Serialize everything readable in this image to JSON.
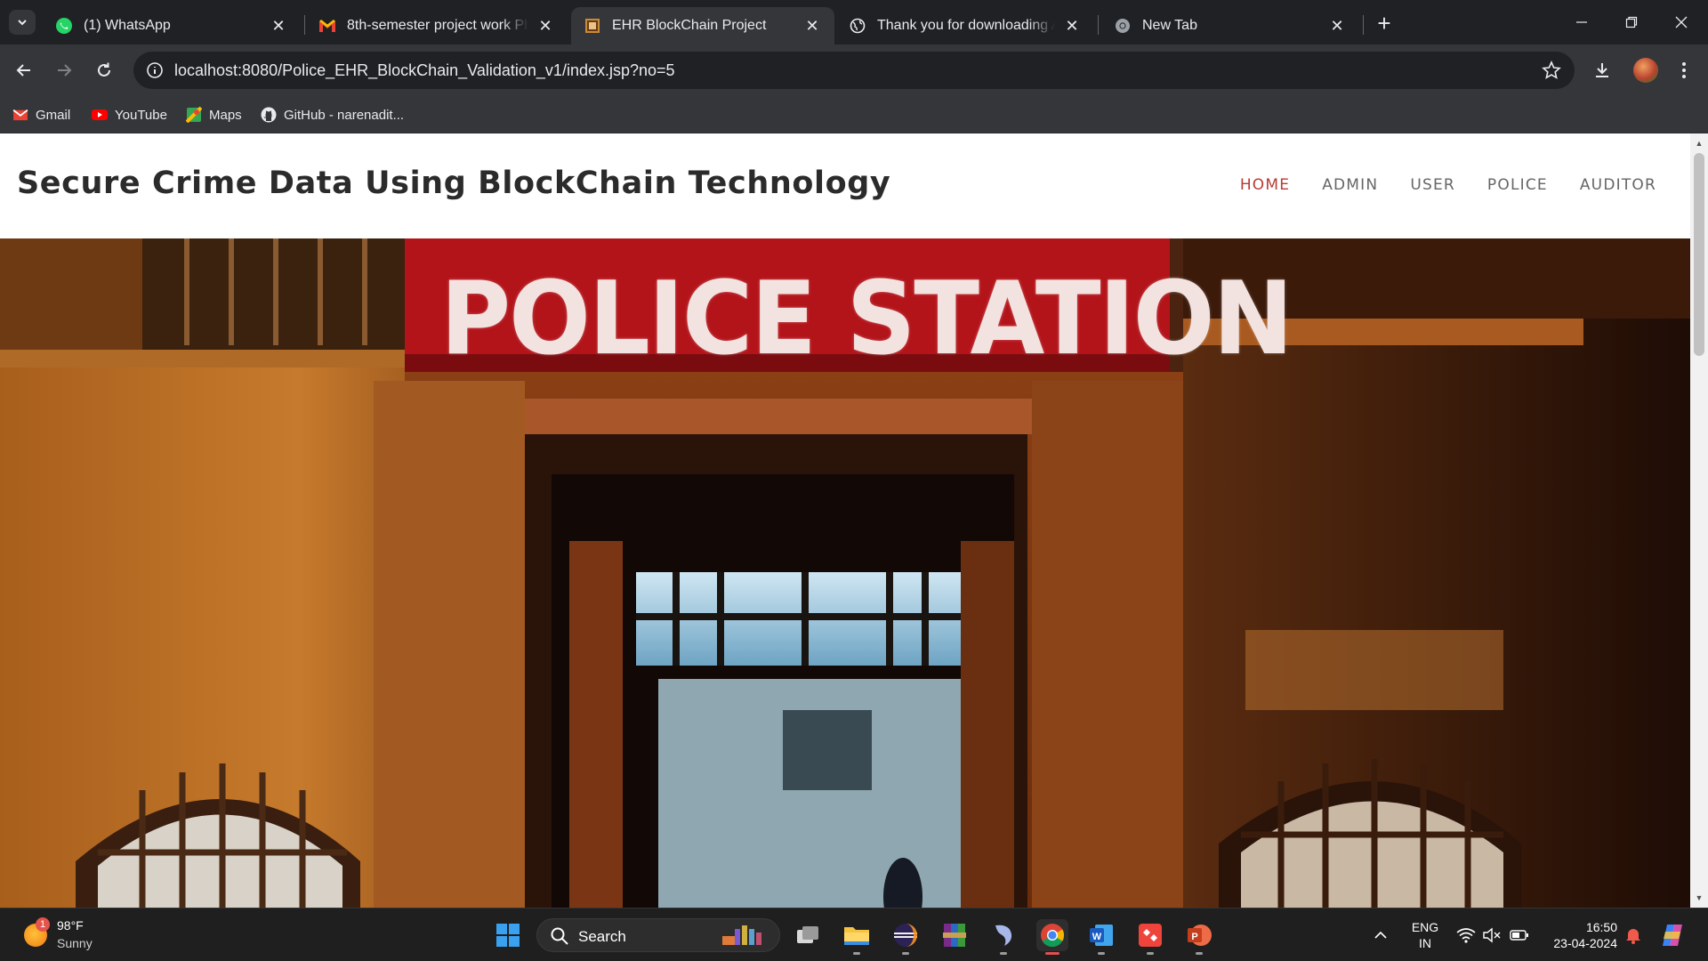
{
  "browser": {
    "tabs": [
      {
        "title": "(1) WhatsApp",
        "icon": "whatsapp-icon",
        "active": false
      },
      {
        "title": "8th-semester project work Pha",
        "icon": "gmail-icon",
        "active": false
      },
      {
        "title": "EHR BlockChain Project",
        "icon": "site-favicon-icon",
        "active": true
      },
      {
        "title": "Thank you for downloading Ar",
        "icon": "globe-icon",
        "active": false
      },
      {
        "title": "New Tab",
        "icon": "chrome-icon",
        "active": false
      }
    ],
    "new_tab_label": "+",
    "url": "localhost:8080/Police_EHR_BlockChain_Validation_v1/index.jsp?no=5",
    "bookmarks": [
      {
        "label": "Gmail",
        "icon": "gmail-icon"
      },
      {
        "label": "YouTube",
        "icon": "youtube-icon"
      },
      {
        "label": "Maps",
        "icon": "maps-icon"
      },
      {
        "label": "GitHub - narenadit...",
        "icon": "github-icon"
      }
    ]
  },
  "site": {
    "title": "Secure Crime Data Using BlockChain Technology",
    "nav": [
      {
        "label": "HOME",
        "active": true
      },
      {
        "label": "ADMIN",
        "active": false
      },
      {
        "label": "USER",
        "active": false
      },
      {
        "label": "POLICE",
        "active": false
      },
      {
        "label": "AUDITOR",
        "active": false
      }
    ],
    "hero_sign": "POLICE STATION",
    "accent_color": "#b83b33"
  },
  "taskbar": {
    "weather": {
      "temp": "98°F",
      "condition": "Sunny",
      "badge": "1"
    },
    "search_label": "Search",
    "language": {
      "line1": "ENG",
      "line2": "IN"
    },
    "clock": {
      "time": "16:50",
      "date": "23-04-2024"
    }
  }
}
